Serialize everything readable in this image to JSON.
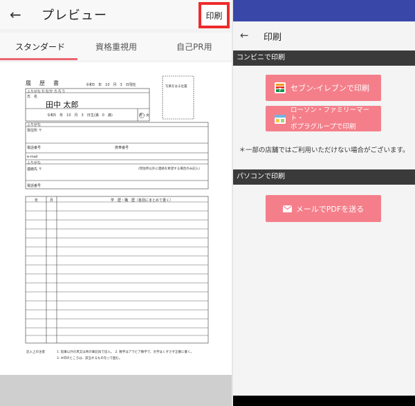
{
  "left": {
    "title": "プレビュー",
    "print_button": "印刷",
    "tabs": [
      "スタンダード",
      "資格重視用",
      "自己PR用"
    ],
    "resume": {
      "heading": "履　歴　書",
      "date": "令和5　年　10　月　3　日現在",
      "furigana_label": "ふりがな",
      "furigana_value": "たなか たろう",
      "name_label": "氏　名",
      "name_value": "田中 太郎",
      "birth": "令和5　年　10　月　3　日生(満　0　歳)",
      "gender": "男・女",
      "photo_text": "写真をはる位置",
      "address_label": "現住所 〒",
      "phone_label": "電話番号",
      "mobile_label": "携帯番号",
      "email_label": "e-mail",
      "contact_label": "連絡先 〒",
      "contact_note": "(現住所以外に連絡を希望する場合のみ記入)",
      "contact_phone_label": "電話番号",
      "col_year": "年",
      "col_month": "月",
      "col_history": "学　歴・職　歴（各別にまとめて書く）",
      "footer_label": "記入上の注意",
      "footer_line1": "1. 鉛筆以外の黒又は青の筆記具で記入。　2. 数字はアラビア数字で、文字はくずさず正確に書く。",
      "footer_line2": "3. ※印のところは、該当するものを○で囲む。"
    }
  },
  "right": {
    "title": "印刷",
    "section1": "コンビニで印刷",
    "btn_seven": "セブン-イレブンで印刷",
    "btn_lawson_line1": "ローソン・ファミリーマート・",
    "btn_lawson_line2": "ポプラグループで印刷",
    "note": "＊一部の店舗ではご利用いただけない場合がございます。",
    "section2": "パソコンで印刷",
    "btn_mail": "メールでPDFを送る"
  },
  "colors": {
    "accent": "#f47f8a",
    "highlight": "#ee2b2b",
    "status_bar": "#3847a8"
  }
}
